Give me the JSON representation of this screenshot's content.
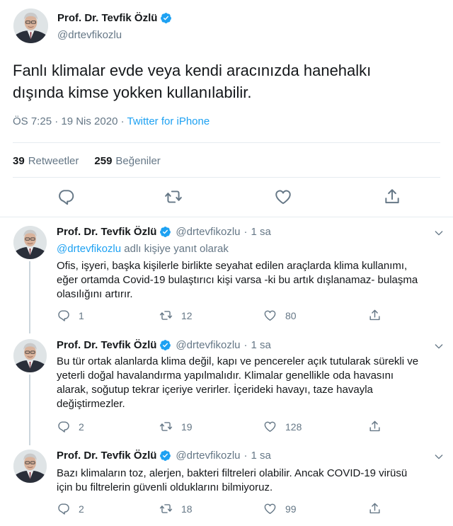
{
  "author": {
    "name": "Prof. Dr. Tevfik Özlü",
    "handle": "@drtevfikozlu"
  },
  "main_tweet": {
    "text_line1": "Fanlı klimalar evde veya kendi aracınızda hanehalkı",
    "text_line2": "dışında kimse yokken kullanılabilir.",
    "time": "ÖS 7:25 · 19 Nis 2020 · ",
    "source": "Twitter for iPhone",
    "retweets": "39",
    "retweets_label": "Retweetler",
    "likes": "259",
    "likes_label": "Beğeniler"
  },
  "replies": [
    {
      "name": "Prof. Dr. Tevfik Özlü",
      "handle": "@drtevfikozlu",
      "dot": "·",
      "time": "1 sa",
      "replying_mention": "@drtevfikozlu",
      "replying_suffix": " adlı kişiye yanıt olarak",
      "lines": [
        "Ofis, işyeri, başka kişilerle birlikte seyahat edilen araçlarda klima kullanımı,",
        "eğer ortamda Covid-19 bulaştırıcı kişi varsa -ki bu artık dışlanamaz- bulaşma",
        "olasılığını artırır."
      ],
      "reply_count": "1",
      "retweet_count": "12",
      "like_count": "80"
    },
    {
      "name": "Prof. Dr. Tevfik Özlü",
      "handle": "@drtevfikozlu",
      "dot": "·",
      "time": "1 sa",
      "lines": [
        "Bu tür ortak alanlarda klima değil, kapı ve pencereler açık tutularak sürekli ve",
        "yeterli doğal havalandırma yapılmalıdır. Klimalar genellikle oda havasını",
        "alarak, soğutup tekrar içeriye verirler.  İçerideki havayı, taze havayla",
        "değiştirmezler."
      ],
      "reply_count": "2",
      "retweet_count": "19",
      "like_count": "128"
    },
    {
      "name": "Prof. Dr. Tevfik Özlü",
      "handle": "@drtevfikozlu",
      "dot": "·",
      "time": "1 sa",
      "lines": [
        "Bazı klimaların toz, alerjen, bakteri filtreleri olabilir. Ancak COVID-19 virüsü",
        "için bu filtrelerin güvenli olduklarını bilmiyoruz."
      ],
      "reply_count": "2",
      "retweet_count": "18",
      "like_count": "99"
    }
  ],
  "colors": {
    "accent": "#1da1f2",
    "muted": "#657786",
    "text": "#14171a",
    "divider": "#e6ecf0"
  },
  "icons": [
    "verified-badge-icon",
    "reply-icon",
    "retweet-icon",
    "like-icon",
    "share-icon",
    "chevron-down-icon"
  ]
}
